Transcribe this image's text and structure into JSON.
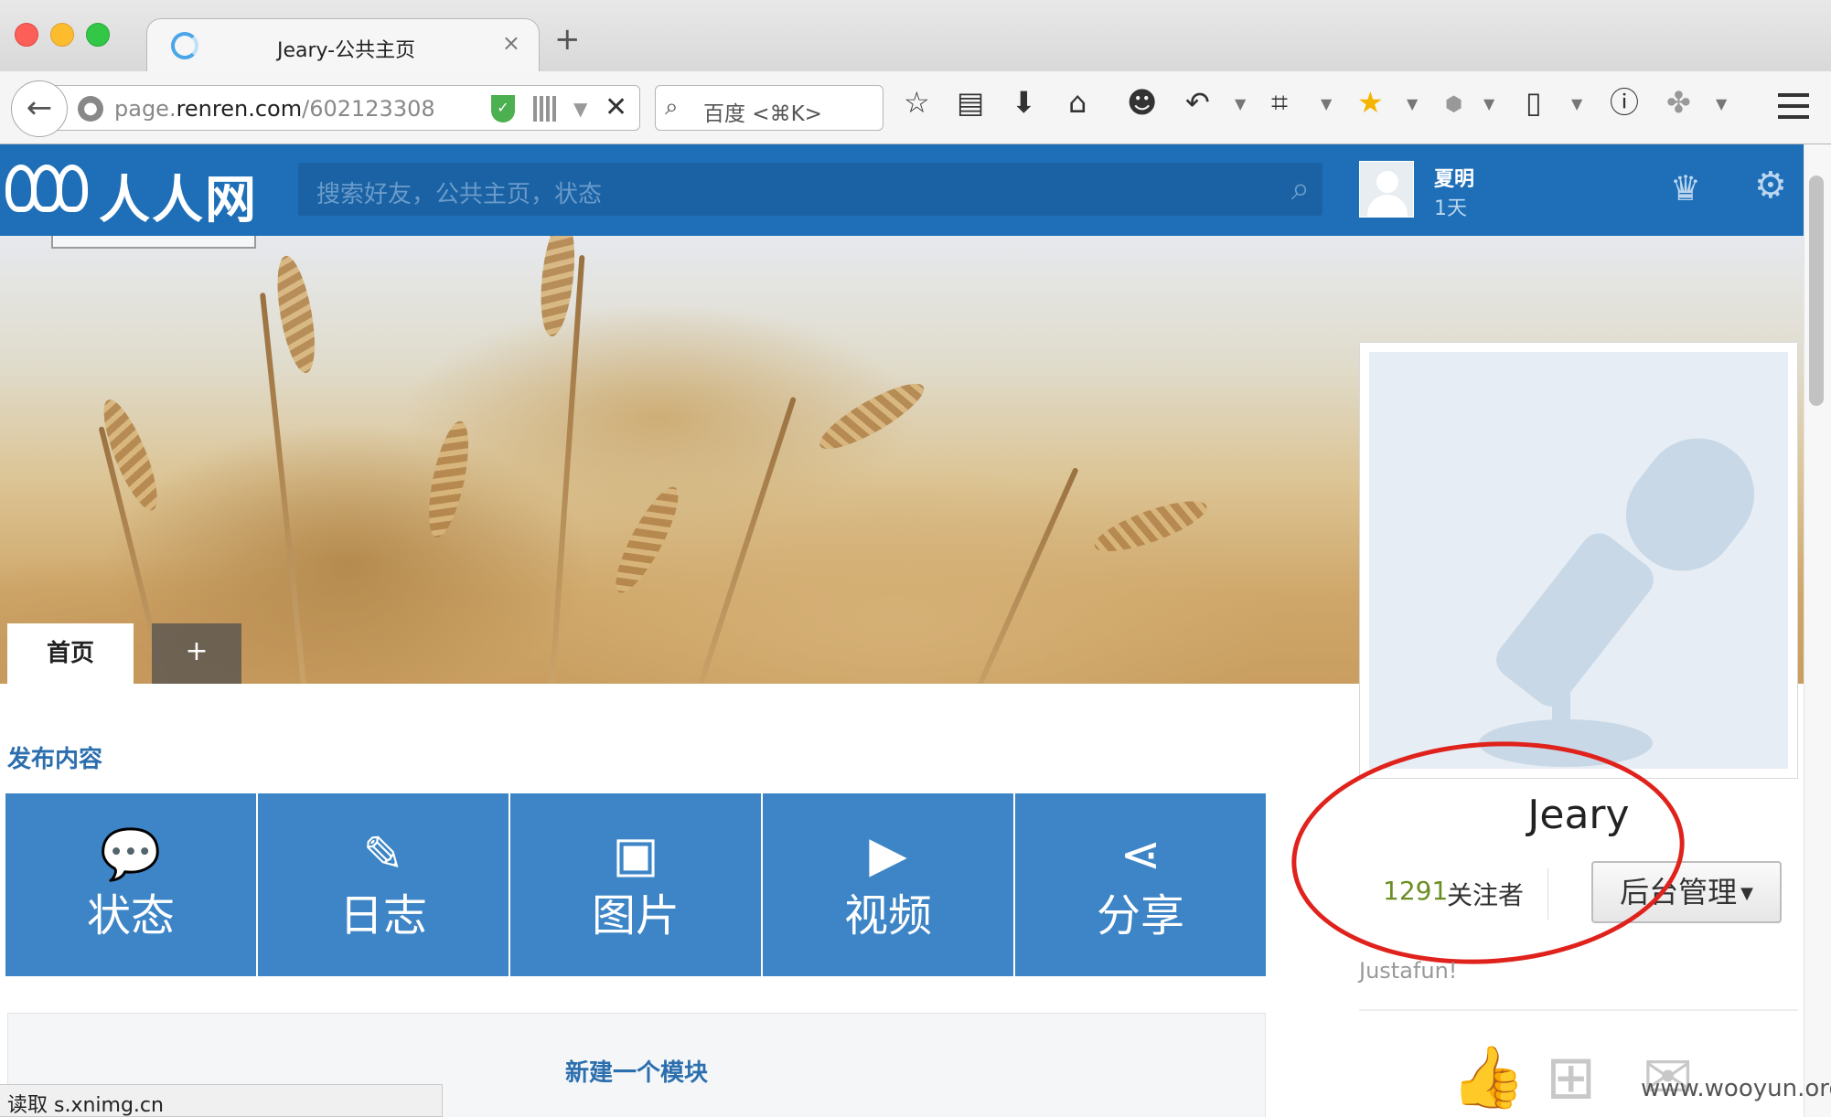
{
  "browser": {
    "tab_title": "Jeary-公共主页",
    "url_host_prefix": "page.",
    "url_host_main": "renren.com",
    "url_path": "/602123308",
    "search_placeholder": "百度 <⌘K>",
    "status_text": "读取 s.xnimg.cn"
  },
  "site": {
    "logo_text": "人人网",
    "search_placeholder": "搜索好友，公共主页，状态",
    "user_name": "夏明",
    "user_days": "1天"
  },
  "page": {
    "tabs": [
      {
        "label": "首页"
      },
      {
        "label": "+"
      }
    ],
    "publish_title": "发布内容",
    "actions": [
      {
        "label": "状态",
        "icon": "chat-bubble-icon",
        "glyph": "💬"
      },
      {
        "label": "日志",
        "icon": "edit-icon",
        "glyph": "✎"
      },
      {
        "label": "图片",
        "icon": "image-icon",
        "glyph": "▣"
      },
      {
        "label": "视频",
        "icon": "video-icon",
        "glyph": "▶"
      },
      {
        "label": "分享",
        "icon": "share-icon",
        "glyph": "⋖"
      }
    ],
    "new_module": "新建一个模块"
  },
  "profile": {
    "name": "Jeary",
    "follower_count": "1291",
    "follower_label": "关注者",
    "manage_label": "后台管理",
    "tagline": "Justafun!"
  },
  "watermark": "www.wooyun.org",
  "colors": {
    "header_blue": "#1e6fb8",
    "action_blue": "#3d85c6",
    "link_blue": "#2c6fae",
    "follower_green": "#6b8e23",
    "annotation_red": "#e0221c"
  }
}
